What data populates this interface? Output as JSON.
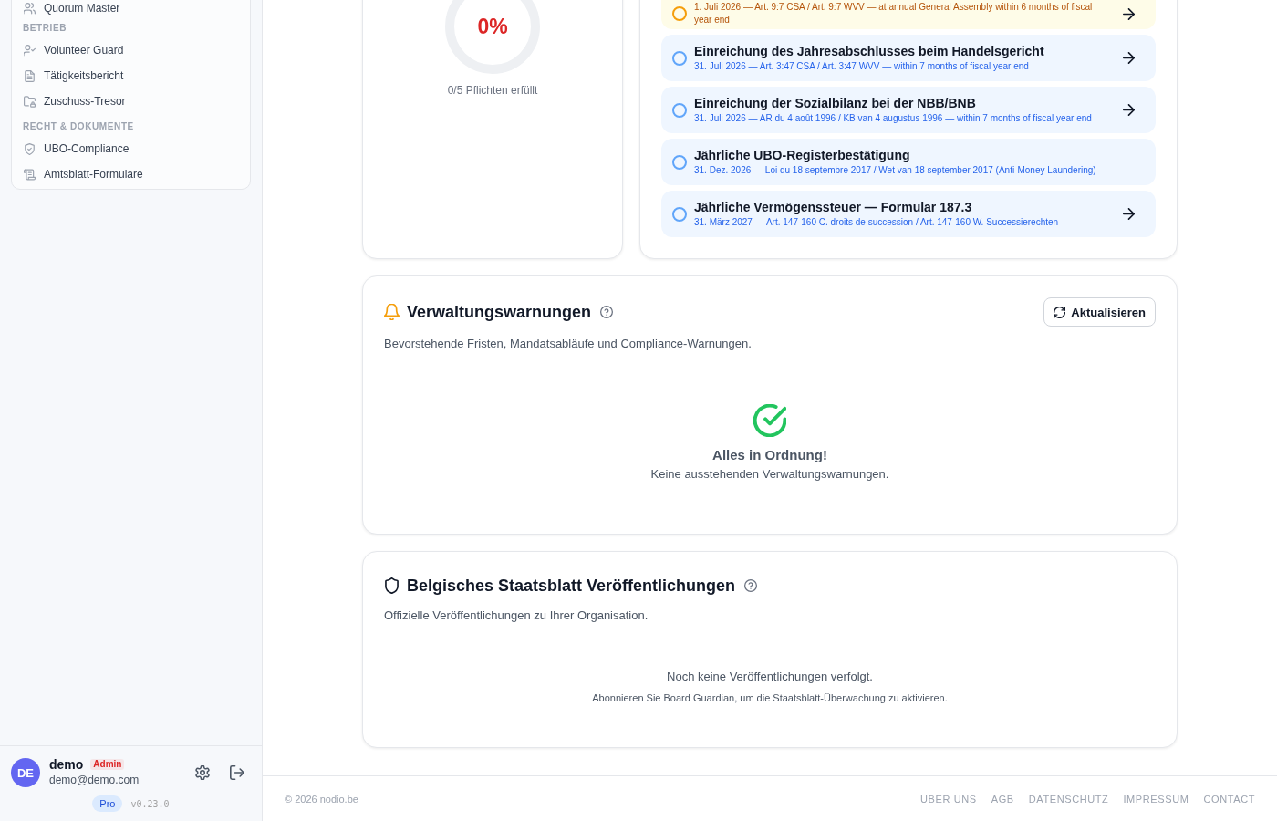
{
  "sidebar": {
    "sections": [
      {
        "items": [
          {
            "label": "Quorum Master",
            "selected": false
          }
        ]
      },
      {
        "heading": "BETRIEB",
        "items": [
          {
            "label": "Volunteer Guard",
            "selected": false
          },
          {
            "label": "Tätigkeitsbericht",
            "selected": false
          },
          {
            "label": "Zuschuss-Tresor",
            "selected": false
          }
        ]
      },
      {
        "heading": "RECHT & DOKUMENTE",
        "items": [
          {
            "label": "UBO-Compliance",
            "selected": false
          },
          {
            "label": "Amtsblatt-Formulare",
            "selected": false
          }
        ]
      }
    ],
    "user": {
      "initials": "DE",
      "name": "demo",
      "role": "Admin",
      "email": "demo@demo.com",
      "plan": "Pro",
      "version": "v0.23.0"
    }
  },
  "progress": {
    "percent": "0%",
    "caption": "0/5 Pflichten erfüllt"
  },
  "obligations": [
    {
      "kind": "due",
      "detail": "1. Juli 2026 — Art. 9:7 CSA / Art. 9:7 WVV — at annual General Assembly within 6 months of fiscal year end",
      "checked": false,
      "link": true
    },
    {
      "kind": "upcoming",
      "title": "Einreichung des Jahresabschlusses beim Handelsgericht",
      "detail": "31. Juli 2026 — Art. 3:47 CSA / Art. 3:47 WVV — within 7 months of fiscal year end",
      "checked": false,
      "link": true
    },
    {
      "kind": "upcoming",
      "title": "Einreichung der Sozialbilanz bei der NBB/BNB",
      "detail": "31. Juli 2026 — AR du 4 août 1996 / KB van 4 augustus 1996 — within 7 months of fiscal year end",
      "checked": false,
      "link": true
    },
    {
      "kind": "upcoming",
      "title": "Jährliche UBO-Registerbestätigung",
      "detail": "31. Dez. 2026 — Loi du 18 septembre 2017 / Wet van 18 september 2017 (Anti-Money Laundering)",
      "checked": false,
      "link": false
    },
    {
      "kind": "upcoming",
      "title": "Jährliche Vermögenssteuer — Formular 187.3",
      "detail": "31. März 2027 — Art. 147-160 C. droits de succession / Art. 147-160 W. Successierechten",
      "checked": false,
      "link": true
    }
  ],
  "panels": [
    {
      "kind": "alerts",
      "title": "Verwaltungswarnungen",
      "description": "Bevorstehende Fristen, Mandatsabläufe und Compliance-Warnungen.",
      "button": "Aktualisieren",
      "empty_title": "Alles in Ordnung!",
      "empty_text": "Keine ausstehenden Verwaltungswarnungen."
    },
    {
      "kind": "gazette",
      "title": "Belgisches Staatsblatt Veröffentlichungen",
      "description": "Offizielle Veröffentlichungen zu Ihrer Organisation.",
      "empty_title": "Noch keine Veröffentlichungen verfolgt.",
      "empty_text": "Abonnieren Sie Board Guardian, um die Staatsblatt-Überwachung zu aktivieren."
    }
  ],
  "footer": {
    "copyright": "© 2026 nodio.be",
    "links": [
      "ÜBER UNS",
      "AGB",
      "DATENSCHUTZ",
      "IMPRESSUM",
      "CONTACT"
    ]
  }
}
